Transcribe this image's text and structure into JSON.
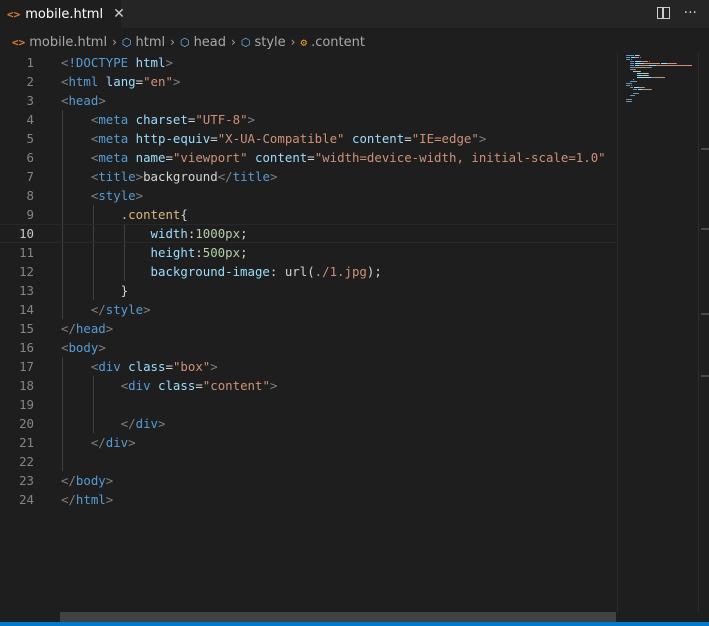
{
  "tab": {
    "icon": "html-file-icon",
    "label": "mobile.html",
    "close": "✕"
  },
  "breadcrumb": [
    {
      "label": "mobile.html",
      "icon": "html-file-icon"
    },
    {
      "label": "html",
      "icon": "element-icon"
    },
    {
      "label": "head",
      "icon": "element-icon"
    },
    {
      "label": "style",
      "icon": "element-icon"
    },
    {
      "label": ".content",
      "icon": "property-icon"
    }
  ],
  "editor": {
    "current_line": 10,
    "lines": [
      {
        "n": "1",
        "tokens": [
          [
            "t-punc",
            "<"
          ],
          [
            "t-tag",
            "!DOCTYPE"
          ],
          [
            "t-text",
            " "
          ],
          [
            "t-attr",
            "html"
          ],
          [
            "t-punc",
            ">"
          ]
        ]
      },
      {
        "n": "2",
        "tokens": [
          [
            "t-punc",
            "<"
          ],
          [
            "t-tag",
            "html"
          ],
          [
            "t-text",
            " "
          ],
          [
            "t-attr",
            "lang"
          ],
          [
            "t-text",
            "="
          ],
          [
            "t-str",
            "\"en\""
          ],
          [
            "t-punc",
            ">"
          ]
        ]
      },
      {
        "n": "3",
        "tokens": [
          [
            "t-punc",
            "<"
          ],
          [
            "t-tag",
            "head"
          ],
          [
            "t-punc",
            ">"
          ]
        ]
      },
      {
        "n": "4",
        "tokens": [
          [
            "t-text",
            "    "
          ],
          [
            "t-punc",
            "<"
          ],
          [
            "t-tag",
            "meta"
          ],
          [
            "t-text",
            " "
          ],
          [
            "t-attr",
            "charset"
          ],
          [
            "t-text",
            "="
          ],
          [
            "t-str",
            "\"UTF-8\""
          ],
          [
            "t-punc",
            ">"
          ]
        ]
      },
      {
        "n": "5",
        "tokens": [
          [
            "t-text",
            "    "
          ],
          [
            "t-punc",
            "<"
          ],
          [
            "t-tag",
            "meta"
          ],
          [
            "t-text",
            " "
          ],
          [
            "t-attr",
            "http-equiv"
          ],
          [
            "t-text",
            "="
          ],
          [
            "t-str",
            "\"X-UA-Compatible\""
          ],
          [
            "t-text",
            " "
          ],
          [
            "t-attr",
            "content"
          ],
          [
            "t-text",
            "="
          ],
          [
            "t-str",
            "\"IE=edge\""
          ],
          [
            "t-punc",
            ">"
          ]
        ]
      },
      {
        "n": "6",
        "tokens": [
          [
            "t-text",
            "    "
          ],
          [
            "t-punc",
            "<"
          ],
          [
            "t-tag",
            "meta"
          ],
          [
            "t-text",
            " "
          ],
          [
            "t-attr",
            "name"
          ],
          [
            "t-text",
            "="
          ],
          [
            "t-str",
            "\"viewport\""
          ],
          [
            "t-text",
            " "
          ],
          [
            "t-attr",
            "content"
          ],
          [
            "t-text",
            "="
          ],
          [
            "t-str",
            "\"width=device-width, initial-scale=1.0\""
          ]
        ]
      },
      {
        "n": "7",
        "tokens": [
          [
            "t-text",
            "    "
          ],
          [
            "t-punc",
            "<"
          ],
          [
            "t-tag",
            "title"
          ],
          [
            "t-punc",
            ">"
          ],
          [
            "t-text",
            "background"
          ],
          [
            "t-punc",
            "</"
          ],
          [
            "t-tag",
            "title"
          ],
          [
            "t-punc",
            ">"
          ]
        ]
      },
      {
        "n": "8",
        "tokens": [
          [
            "t-text",
            "    "
          ],
          [
            "t-punc",
            "<"
          ],
          [
            "t-tag",
            "style"
          ],
          [
            "t-punc",
            ">"
          ]
        ]
      },
      {
        "n": "9",
        "tokens": [
          [
            "t-text",
            "        "
          ],
          [
            "t-sel",
            ".content"
          ],
          [
            "t-text",
            "{"
          ]
        ]
      },
      {
        "n": "10",
        "tokens": [
          [
            "t-text",
            "            "
          ],
          [
            "t-attr",
            "width"
          ],
          [
            "t-text",
            ":"
          ],
          [
            "t-num",
            "1000px"
          ],
          [
            "t-text",
            ";"
          ]
        ]
      },
      {
        "n": "11",
        "tokens": [
          [
            "t-text",
            "            "
          ],
          [
            "t-attr",
            "height"
          ],
          [
            "t-text",
            ":"
          ],
          [
            "t-num",
            "500px"
          ],
          [
            "t-text",
            ";"
          ]
        ]
      },
      {
        "n": "12",
        "tokens": [
          [
            "t-text",
            "            "
          ],
          [
            "t-attr",
            "background-image"
          ],
          [
            "t-text",
            ": "
          ],
          [
            "t-text",
            "url("
          ],
          [
            "t-str",
            "./1.jpg"
          ],
          [
            "t-text",
            ");"
          ]
        ]
      },
      {
        "n": "13",
        "tokens": [
          [
            "t-text",
            "        "
          ],
          [
            "t-text",
            "}"
          ]
        ]
      },
      {
        "n": "14",
        "tokens": [
          [
            "t-text",
            "    "
          ],
          [
            "t-punc",
            "</"
          ],
          [
            "t-tag",
            "style"
          ],
          [
            "t-punc",
            ">"
          ]
        ]
      },
      {
        "n": "15",
        "tokens": [
          [
            "t-punc",
            "</"
          ],
          [
            "t-tag",
            "head"
          ],
          [
            "t-punc",
            ">"
          ]
        ]
      },
      {
        "n": "16",
        "tokens": [
          [
            "t-punc",
            "<"
          ],
          [
            "t-tag",
            "body"
          ],
          [
            "t-punc",
            ">"
          ]
        ]
      },
      {
        "n": "17",
        "tokens": [
          [
            "t-text",
            "    "
          ],
          [
            "t-punc",
            "<"
          ],
          [
            "t-tag",
            "div"
          ],
          [
            "t-text",
            " "
          ],
          [
            "t-attr",
            "class"
          ],
          [
            "t-text",
            "="
          ],
          [
            "t-str",
            "\"box\""
          ],
          [
            "t-punc",
            ">"
          ]
        ]
      },
      {
        "n": "18",
        "tokens": [
          [
            "t-text",
            "        "
          ],
          [
            "t-punc",
            "<"
          ],
          [
            "t-tag",
            "div"
          ],
          [
            "t-text",
            " "
          ],
          [
            "t-attr",
            "class"
          ],
          [
            "t-text",
            "="
          ],
          [
            "t-str",
            "\"content\""
          ],
          [
            "t-punc",
            ">"
          ]
        ]
      },
      {
        "n": "19",
        "tokens": []
      },
      {
        "n": "20",
        "tokens": [
          [
            "t-text",
            "        "
          ],
          [
            "t-punc",
            "</"
          ],
          [
            "t-tag",
            "div"
          ],
          [
            "t-punc",
            ">"
          ]
        ]
      },
      {
        "n": "21",
        "tokens": [
          [
            "t-text",
            "    "
          ],
          [
            "t-punc",
            "</"
          ],
          [
            "t-tag",
            "div"
          ],
          [
            "t-punc",
            ">"
          ]
        ]
      },
      {
        "n": "22",
        "tokens": []
      },
      {
        "n": "23",
        "tokens": [
          [
            "t-punc",
            "</"
          ],
          [
            "t-tag",
            "body"
          ],
          [
            "t-punc",
            ">"
          ]
        ]
      },
      {
        "n": "24",
        "tokens": [
          [
            "t-punc",
            "</"
          ],
          [
            "t-tag",
            "html"
          ],
          [
            "t-punc",
            ">"
          ]
        ]
      }
    ]
  },
  "colors": {
    "accent": "#007acc",
    "background": "#1e1e1e",
    "tab_bar": "#252526"
  }
}
